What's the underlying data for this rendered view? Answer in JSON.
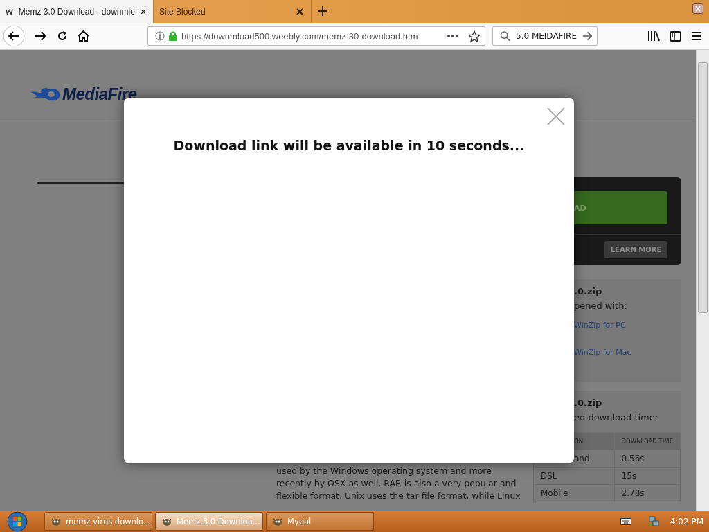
{
  "browser": {
    "tabs": [
      {
        "title": "Memz 3.0 Download - downmlo",
        "selected": true
      },
      {
        "title": "Site Blocked",
        "selected": false
      }
    ],
    "url": "https://downmload500.weebly.com/memz-30-download.htm",
    "search": {
      "value": "5.0 MEIDAFIRE"
    }
  },
  "page": {
    "logo": "MediaFire",
    "download_button": "AD",
    "learn_more": "LEARN MORE",
    "panels": [
      {
        "title": ".0.zip",
        "subtitle": "pened with:",
        "links": [
          "WinZip for PC",
          "WinZip for Mac"
        ]
      },
      {
        "title": ".0.zip",
        "subtitle": "ed download time:"
      }
    ],
    "table": {
      "columns": [
        "ON",
        "DOWNLOAD TIME"
      ],
      "rows": [
        [
          "and",
          "0.56s"
        ],
        [
          "DSL",
          "15s"
        ],
        [
          "Mobile",
          "2.78s"
        ]
      ]
    },
    "paragraph": [
      "used by the Windows operating system and more",
      "recently by OSX as well. RAR is also a very popular and",
      "flexible format. Unix uses the tar file format, while Linux"
    ]
  },
  "modal": {
    "message": "Download link will be available in 10 seconds..."
  },
  "taskbar": {
    "items": [
      {
        "label": "memz virus downlo...",
        "selected": false
      },
      {
        "label": "Memz 3.0 Downloa...",
        "selected": true
      },
      {
        "label": "Mypal",
        "selected": false
      }
    ],
    "clock": "4:02 PM"
  }
}
